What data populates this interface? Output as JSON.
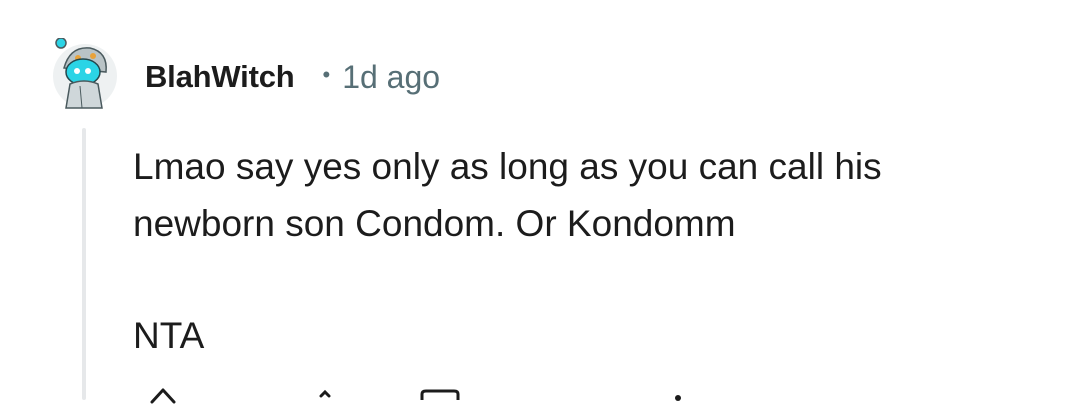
{
  "comment": {
    "author": "BlahWitch",
    "separator": "•",
    "age": "1d ago",
    "body_lines": [
      "Lmao say yes only as long as you can call his",
      "newborn son Condom. Or Kondomm"
    ],
    "verdict": "NTA"
  },
  "icons": {
    "avatar": "snoo-avatar",
    "upvote": "upvote-arrow-icon",
    "downvote": "downvote-arrow-icon",
    "reply": "reply-icon",
    "more": "more-icon"
  },
  "colors": {
    "text": "#1c1c1c",
    "meta": "#576f76",
    "thread_line": "#e6e8ea",
    "avatar_accent": "#2bd4e6"
  }
}
